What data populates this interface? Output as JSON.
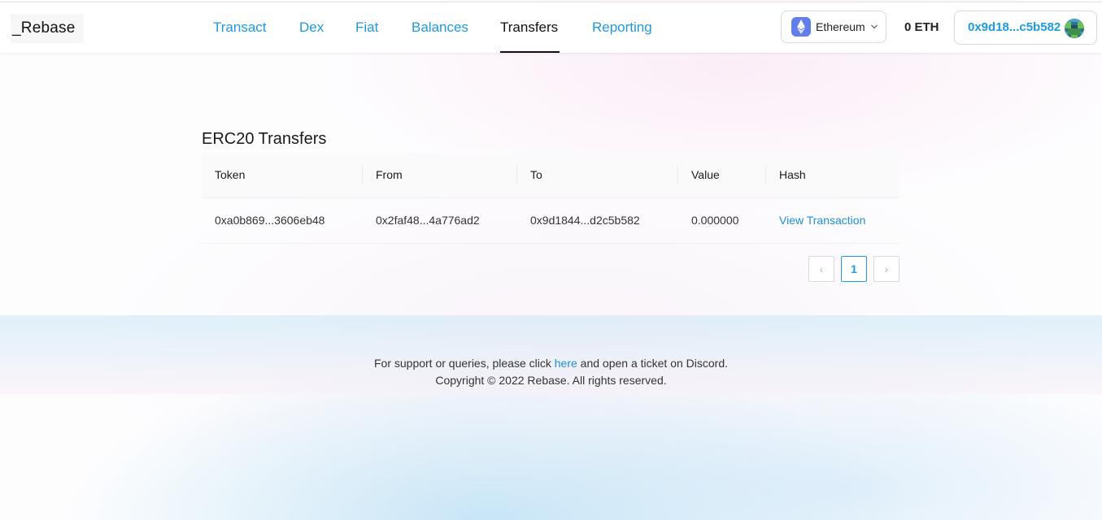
{
  "header": {
    "logo": "_Rebase",
    "nav": [
      {
        "label": "Transact",
        "active": false
      },
      {
        "label": "Dex",
        "active": false
      },
      {
        "label": "Fiat",
        "active": false
      },
      {
        "label": "Balances",
        "active": false
      },
      {
        "label": "Transfers",
        "active": true
      },
      {
        "label": "Reporting",
        "active": false
      }
    ],
    "network": {
      "label": "Ethereum",
      "icon": "ethereum-icon",
      "color": "#627eea"
    },
    "balance": "0 ETH",
    "account": "0x9d18...c5b582"
  },
  "main": {
    "title": "ERC20 Transfers",
    "columns": [
      "Token",
      "From",
      "To",
      "Value",
      "Hash"
    ],
    "rows": [
      {
        "token": "0xa0b869...3606eb48",
        "from": "0x2faf48...4a776ad2",
        "to": "0x9d1844...d2c5b582",
        "value": "0.000000",
        "hash": "View Transaction"
      }
    ],
    "pagination": {
      "current": "1",
      "prev": "‹",
      "next": "›"
    }
  },
  "footer": {
    "text_before": "For support or queries, please click ",
    "link": "here",
    "text_after": " and open a ticket on Discord.",
    "copyright": "Copyright © 2022 Rebase. All rights reserved."
  },
  "colors": {
    "accent": "#1e9ae0",
    "active_nav": "#111111"
  }
}
